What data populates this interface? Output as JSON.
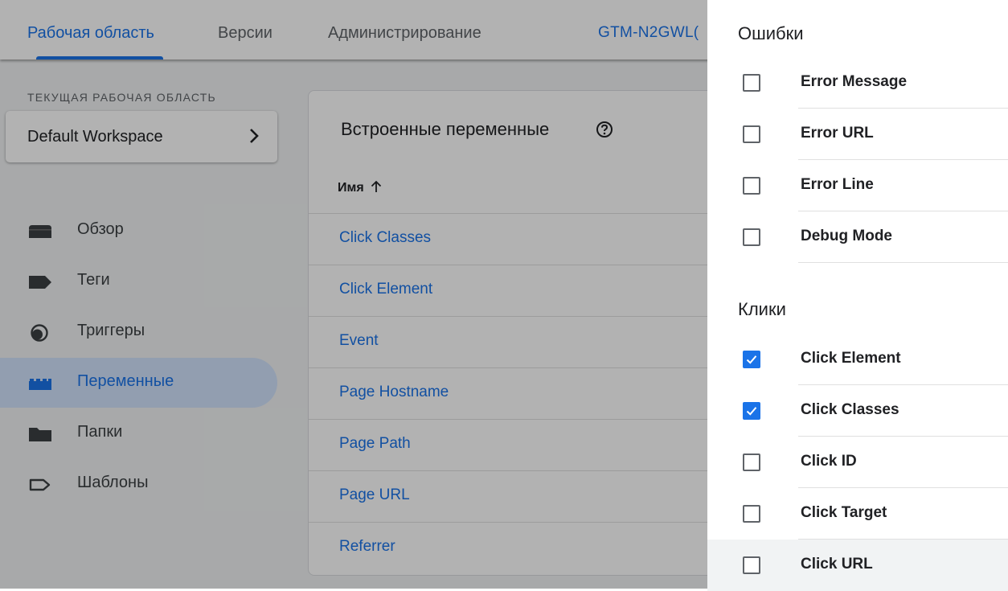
{
  "topnav": {
    "tabs": [
      {
        "label": "Рабочая область",
        "active": true
      },
      {
        "label": "Версии",
        "active": false
      },
      {
        "label": "Администрирование",
        "active": false
      }
    ],
    "container_id": "GTM-N2GWL("
  },
  "workspace": {
    "section_label": "ТЕКУЩАЯ РАБОЧАЯ ОБЛАСТЬ",
    "name": "Default Workspace"
  },
  "sidebar": {
    "items": [
      {
        "label": "Обзор",
        "icon": "overview-icon"
      },
      {
        "label": "Теги",
        "icon": "tag-icon"
      },
      {
        "label": "Триггеры",
        "icon": "trigger-icon"
      },
      {
        "label": "Переменные",
        "icon": "variables-icon",
        "active": true
      },
      {
        "label": "Папки",
        "icon": "folder-icon"
      },
      {
        "label": "Шаблоны",
        "icon": "template-icon"
      }
    ]
  },
  "builtins": {
    "title": "Встроенные переменные",
    "column_name": "Имя",
    "rows": [
      "Click Classes",
      "Click Element",
      "Event",
      "Page Hostname",
      "Page Path",
      "Page URL",
      "Referrer"
    ]
  },
  "panel": {
    "sections": [
      {
        "title": "Ошибки",
        "options": [
          {
            "label": "Error Message",
            "checked": false
          },
          {
            "label": "Error URL",
            "checked": false
          },
          {
            "label": "Error Line",
            "checked": false
          },
          {
            "label": "Debug Mode",
            "checked": false
          }
        ]
      },
      {
        "title": "Клики",
        "options": [
          {
            "label": "Click Element",
            "checked": true
          },
          {
            "label": "Click Classes",
            "checked": true
          },
          {
            "label": "Click ID",
            "checked": false
          },
          {
            "label": "Click Target",
            "checked": false
          },
          {
            "label": "Click URL",
            "checked": false
          }
        ]
      }
    ]
  },
  "colors": {
    "accent": "#1a73e8",
    "active_nav_bg": "#d2e3fc",
    "scrim": "rgba(0,0,0,0.30)"
  }
}
